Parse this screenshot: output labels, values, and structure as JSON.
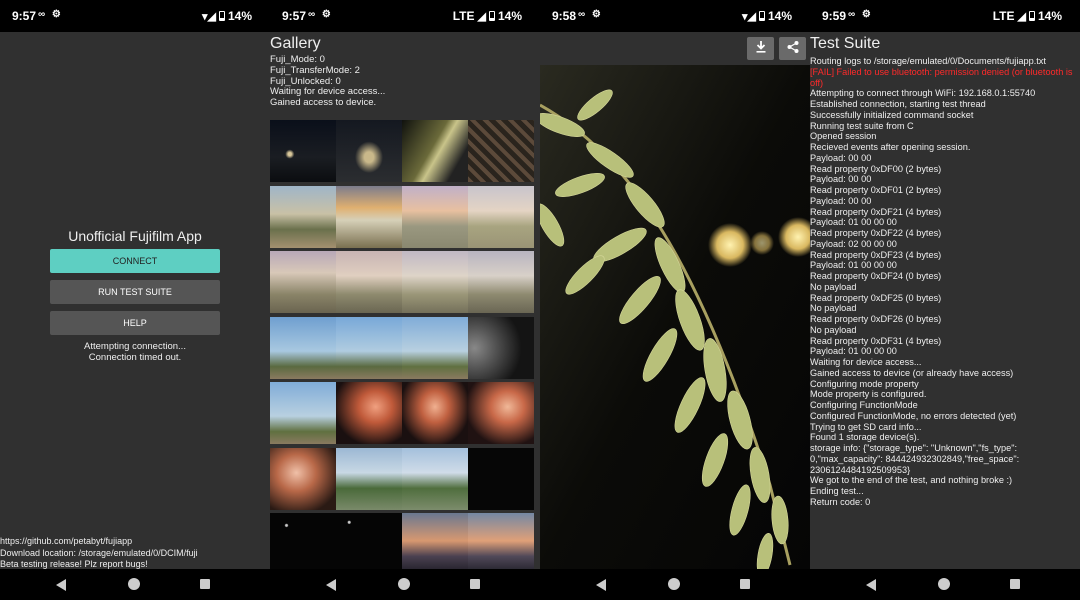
{
  "status_bars": [
    {
      "time": "9:57",
      "network": "",
      "battery": "14%"
    },
    {
      "time": "9:57",
      "network": "LTE",
      "battery": "14%"
    },
    {
      "time": "9:58",
      "network": "",
      "battery": "14%"
    },
    {
      "time": "9:59",
      "network": "LTE",
      "battery": "14%"
    }
  ],
  "home": {
    "title": "Unofficial Fujifilm App",
    "connect_label": "CONNECT",
    "test_suite_label": "RUN TEST SUITE",
    "help_label": "HELP",
    "status_lines": [
      "Attempting connection...",
      "Connection timed out."
    ],
    "footer_lines": [
      "https://github.com/petabyt/fujiapp",
      "Download location: /storage/emulated/0/DCIM/fuji",
      "Beta testing release! Plz report bugs!"
    ]
  },
  "gallery": {
    "title": "Gallery",
    "info_lines": [
      "Fuji_Mode: 0",
      "Fuji_TransferMode: 2",
      "Fuji_Unlocked: 0",
      "Waiting for device access...",
      "Gained access to device."
    ]
  },
  "test_suite": {
    "title": "Test Suite",
    "log": [
      {
        "text": "Routing logs to /storage/emulated/0/Documents/fujiapp.txt",
        "error": false
      },
      {
        "text": "[FAIL] Failed to use bluetooth: permission denied (or bluetooth is off)",
        "error": true
      },
      {
        "text": "Attempting to connect through WiFi: 192.168.0.1:55740",
        "error": false
      },
      {
        "text": "Established connection, starting test thread",
        "error": false
      },
      {
        "text": "Successfully initialized command socket",
        "error": false
      },
      {
        "text": "Running test suite from C",
        "error": false
      },
      {
        "text": "Opened session",
        "error": false
      },
      {
        "text": "Recieved events after opening session.",
        "error": false
      },
      {
        "text": "Payload: 00 00",
        "error": false
      },
      {
        "text": "Read property 0xDF00 (2 bytes)",
        "error": false
      },
      {
        "text": "Payload: 00 00",
        "error": false
      },
      {
        "text": "Read property 0xDF01 (2 bytes)",
        "error": false
      },
      {
        "text": "Payload: 00 00",
        "error": false
      },
      {
        "text": "Read property 0xDF21 (4 bytes)",
        "error": false
      },
      {
        "text": "Payload: 01 00 00 00",
        "error": false
      },
      {
        "text": "Read property 0xDF22 (4 bytes)",
        "error": false
      },
      {
        "text": "Payload: 02 00 00 00",
        "error": false
      },
      {
        "text": "Read property 0xDF23 (4 bytes)",
        "error": false
      },
      {
        "text": "Payload: 01 00 00 00",
        "error": false
      },
      {
        "text": "Read property 0xDF24 (0 bytes)",
        "error": false
      },
      {
        "text": "No payload",
        "error": false
      },
      {
        "text": "Read property 0xDF25 (0 bytes)",
        "error": false
      },
      {
        "text": "No payload",
        "error": false
      },
      {
        "text": "Read property 0xDF26 (0 bytes)",
        "error": false
      },
      {
        "text": "No payload",
        "error": false
      },
      {
        "text": "Read property 0xDF31 (4 bytes)",
        "error": false
      },
      {
        "text": "Payload: 01 00 00 00",
        "error": false
      },
      {
        "text": "Waiting for device access...",
        "error": false
      },
      {
        "text": "Gained access to device (or already have access)",
        "error": false
      },
      {
        "text": "Configuring mode property",
        "error": false
      },
      {
        "text": "Mode property is configured.",
        "error": false
      },
      {
        "text": "Configuring FunctionMode",
        "error": false
      },
      {
        "text": "Configured FunctionMode, no errors detected (yet)",
        "error": false
      },
      {
        "text": "Trying to get SD card info...",
        "error": false
      },
      {
        "text": "Found 1 storage device(s).",
        "error": false
      },
      {
        "text": "storage info: {\"storage_type\": \"Unknown\",\"fs_type\": 0,\"max_capacity\": 844424932302849,\"free_space\": 2306124484192509953}",
        "error": false
      },
      {
        "text": "We got to the end of the test, and nothing broke :)",
        "error": false
      },
      {
        "text": "Ending test...",
        "error": false
      },
      {
        "text": "Return code: 0",
        "error": false
      }
    ]
  },
  "colors": {
    "accent": "#5ecfc2",
    "error": "#ff2a2a",
    "background": "#303030"
  },
  "icons": [
    "wifi-icon",
    "signal-icon",
    "battery-icon",
    "download-icon",
    "share-icon",
    "back-icon",
    "home-icon",
    "recents-icon"
  ]
}
